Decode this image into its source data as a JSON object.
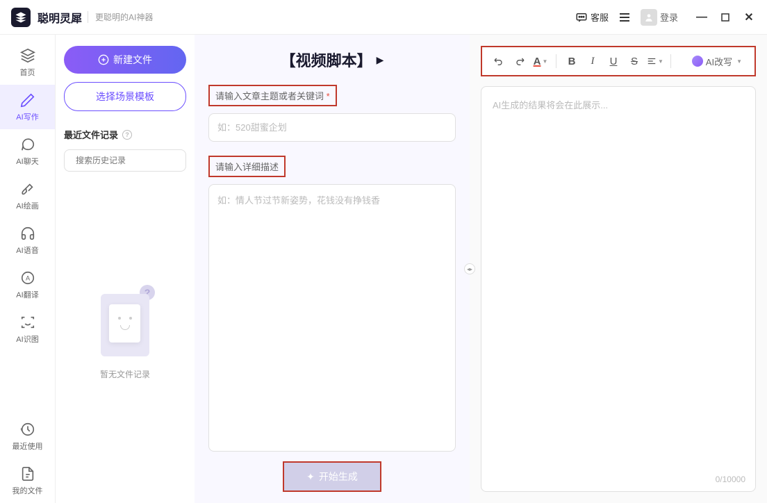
{
  "app": {
    "name": "聪明灵犀",
    "tagline": "更聪明的AI神器"
  },
  "titlebar": {
    "kefu": "客服",
    "login": "登录"
  },
  "nav": {
    "home": "首页",
    "writing": "AI写作",
    "chat": "AI聊天",
    "painting": "AI绘画",
    "voice": "AI语音",
    "translate": "AI翻译",
    "image_recog": "AI识图",
    "recent": "最近使用",
    "my_files": "我的文件"
  },
  "file_panel": {
    "new_file": "新建文件",
    "template": "选择场景模板",
    "recent_label": "最近文件记录",
    "search_placeholder": "搜索历史记录",
    "empty": "暂无文件记录"
  },
  "center": {
    "title": "【视频脚本】",
    "label1": "请输入文章主题或者关键词",
    "req": "*",
    "placeholder1": "如：520甜蜜企划",
    "label2": "请输入详细描述",
    "placeholder2": "如：情人节过节新姿势，花钱没有挣钱香",
    "generate": "开始生成"
  },
  "right": {
    "ai_rewrite": "AI改写",
    "placeholder": "AI生成的结果将会在此展示...",
    "count": "0/10000"
  }
}
